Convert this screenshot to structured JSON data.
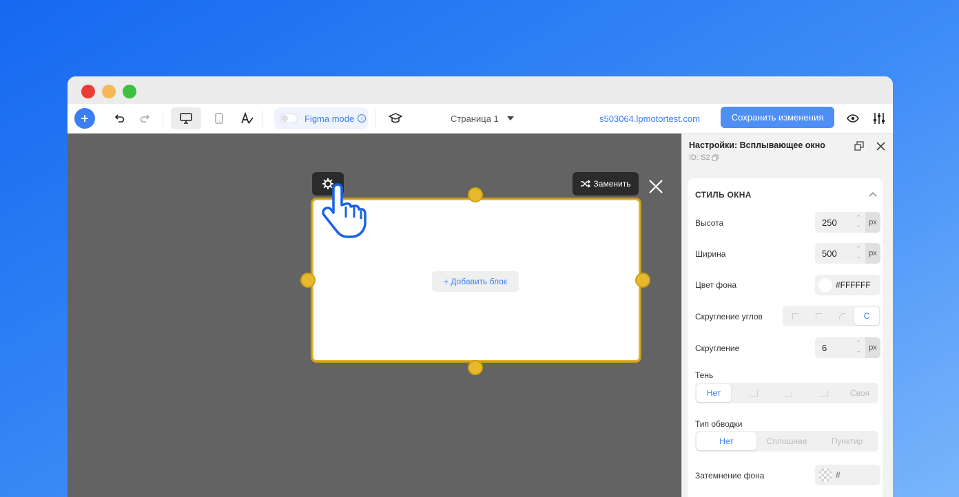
{
  "toolbar": {
    "add_icon": "plus-icon",
    "figma_mode_label": "Figma mode",
    "page_selector": "Страница 1",
    "domain": "s503064.lpmotortest.com",
    "save_label": "Сохранить изменения"
  },
  "canvas": {
    "replace_label": "Заменить",
    "add_block_label": "+ Добавить блок"
  },
  "panel": {
    "title": "Настройки: Всплывающее окно",
    "id_label": "ID: S2",
    "section_title": "СТИЛЬ ОКНА",
    "height": {
      "label": "Высота",
      "value": "250",
      "unit": "px"
    },
    "width": {
      "label": "Ширина",
      "value": "500",
      "unit": "px"
    },
    "bg_color": {
      "label": "Цвет фона",
      "value": "#FFFFFF"
    },
    "corners": {
      "label": "Скругление углов",
      "custom": "C"
    },
    "radius": {
      "label": "Скругление",
      "value": "6",
      "unit": "px"
    },
    "shadow": {
      "label": "Тень",
      "none": "Нет",
      "custom": "Своя"
    },
    "border": {
      "label": "Тип обводки",
      "none": "Нет",
      "solid": "Сплошная",
      "dashed": "Пунктир"
    },
    "overlay": {
      "label": "Затемнение фона",
      "value": "#"
    }
  },
  "colors": {
    "accent": "#3b7ef2",
    "canvas": "#636363",
    "selection": "#e2b52e"
  }
}
